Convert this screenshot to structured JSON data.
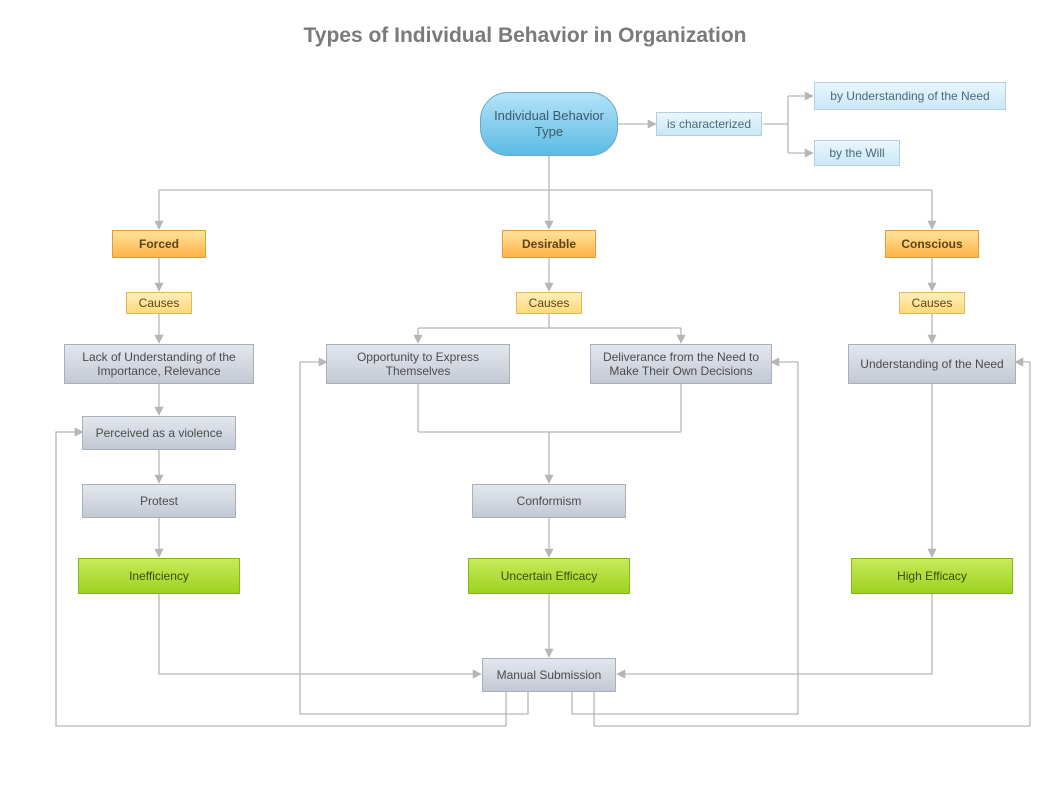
{
  "title": "Types of Individual Behavior in Organization",
  "root": "Individual Behavior Type",
  "characterized_label": "is characterized",
  "characterized_by": {
    "need": "by Understanding of the Need",
    "will": "by the Will"
  },
  "tracks": {
    "forced": {
      "label": "Forced",
      "causes": "Causes",
      "steps": [
        "Lack of Understanding of the Importance, Relevance",
        "Perceived as a violence",
        "Protest"
      ],
      "outcome": "Inefficiency"
    },
    "desirable": {
      "label": "Desirable",
      "causes": "Causes",
      "branches": [
        "Opportunity to Express Themselves",
        "Deliverance from the Need to Make Their Own Decisions"
      ],
      "merge": "Conformism",
      "outcome": "Uncertain Efficacy"
    },
    "conscious": {
      "label": "Conscious",
      "causes": "Causes",
      "step": "Understanding of the Need",
      "outcome": "High Efficacy"
    }
  },
  "sink": "Manual Submission",
  "colors": {
    "root": "#5bbbe4",
    "sky": "#c9e8f7",
    "amber": "#ffb347",
    "gold": "#ffd87a",
    "slate": "#c3c9d4",
    "lime": "#9cd31f"
  }
}
